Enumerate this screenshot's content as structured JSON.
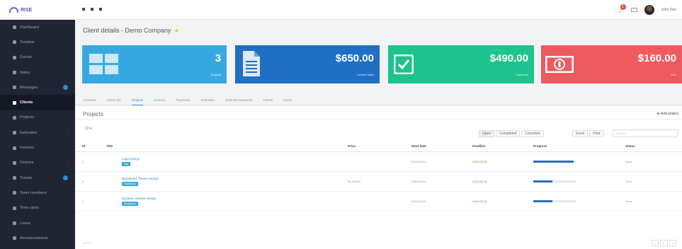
{
  "app": {
    "logo_text": "RISE",
    "username": "John Doe",
    "notification_count": "1"
  },
  "sidebar": {
    "items": [
      {
        "label": "Dashboard",
        "active": false,
        "dot": false,
        "chevron": false
      },
      {
        "label": "Timeline",
        "active": false,
        "dot": false,
        "chevron": false
      },
      {
        "label": "Events",
        "active": false,
        "dot": false,
        "chevron": false
      },
      {
        "label": "Notes",
        "active": false,
        "dot": false,
        "chevron": false
      },
      {
        "label": "Messages",
        "active": false,
        "dot": true,
        "chevron": false
      },
      {
        "label": "Clients",
        "active": true,
        "dot": false,
        "chevron": false
      },
      {
        "label": "Projects",
        "active": false,
        "dot": false,
        "chevron": false
      },
      {
        "label": "Estimates",
        "active": false,
        "dot": false,
        "chevron": true
      },
      {
        "label": "Invoices",
        "active": false,
        "dot": false,
        "chevron": false
      },
      {
        "label": "Finance",
        "active": false,
        "dot": false,
        "chevron": true
      },
      {
        "label": "Tickets",
        "active": false,
        "dot": true,
        "chevron": false
      },
      {
        "label": "Team members",
        "active": false,
        "dot": false,
        "chevron": false
      },
      {
        "label": "Time cards",
        "active": false,
        "dot": false,
        "chevron": false
      },
      {
        "label": "Leave",
        "active": false,
        "dot": false,
        "chevron": false
      },
      {
        "label": "Announcements",
        "active": false,
        "dot": false,
        "chevron": false
      }
    ]
  },
  "header": {
    "title": "Client details - Demo Company"
  },
  "cards": [
    {
      "amount": "3",
      "label": "Projects",
      "icon": "grid-icon",
      "color": "#38a9e0"
    },
    {
      "amount": "$650.00",
      "label": "Invoice Value",
      "icon": "document-icon",
      "color": "#1f6fc4"
    },
    {
      "amount": "$490.00",
      "label": "Payments",
      "icon": "check-icon",
      "color": "#1ec38d"
    },
    {
      "amount": "$160.00",
      "label": "Due",
      "icon": "money-icon",
      "color": "#ee5a60"
    }
  ],
  "tabs": [
    "Contacts",
    "Client info",
    "Projects",
    "Invoices",
    "Payments",
    "Estimates",
    "Estimate Requests",
    "Tickets",
    "Notes"
  ],
  "active_tab": "Projects",
  "projects_panel": {
    "title": "Projects",
    "add_label": "Add project",
    "page_size": "10",
    "filters": [
      "Open",
      "Completed",
      "Canceled"
    ],
    "active_filter": "Open",
    "export": [
      "Excel",
      "Print"
    ],
    "search_placeholder": "Search",
    "columns": [
      "ID",
      "Title",
      "Price",
      "Start date",
      "Deadline",
      "Progress",
      "Status"
    ],
    "rows": [
      {
        "id": "3",
        "title": "Logo Design",
        "tag": "Tag",
        "price": "-",
        "start": "2016-08-01",
        "deadline": "2016-08-08",
        "progress": 0.95,
        "status": "Open"
      },
      {
        "id": "2",
        "title": "Wordpress Theme Design",
        "tag": "Wordpress",
        "price": "$1,500.00",
        "start": "2016-08-01",
        "deadline": "2016-08-16",
        "progress": 0.45,
        "status": "Open"
      },
      {
        "id": "1",
        "title": "Dynamic website design",
        "tag": "Wordpress",
        "price": "-",
        "start": "2016-06-28",
        "deadline": "2016-08-15",
        "progress": 0.45,
        "status": "Open"
      }
    ],
    "footer_info": "1-3 / 3",
    "pager": [
      "<",
      "1",
      ">"
    ]
  }
}
